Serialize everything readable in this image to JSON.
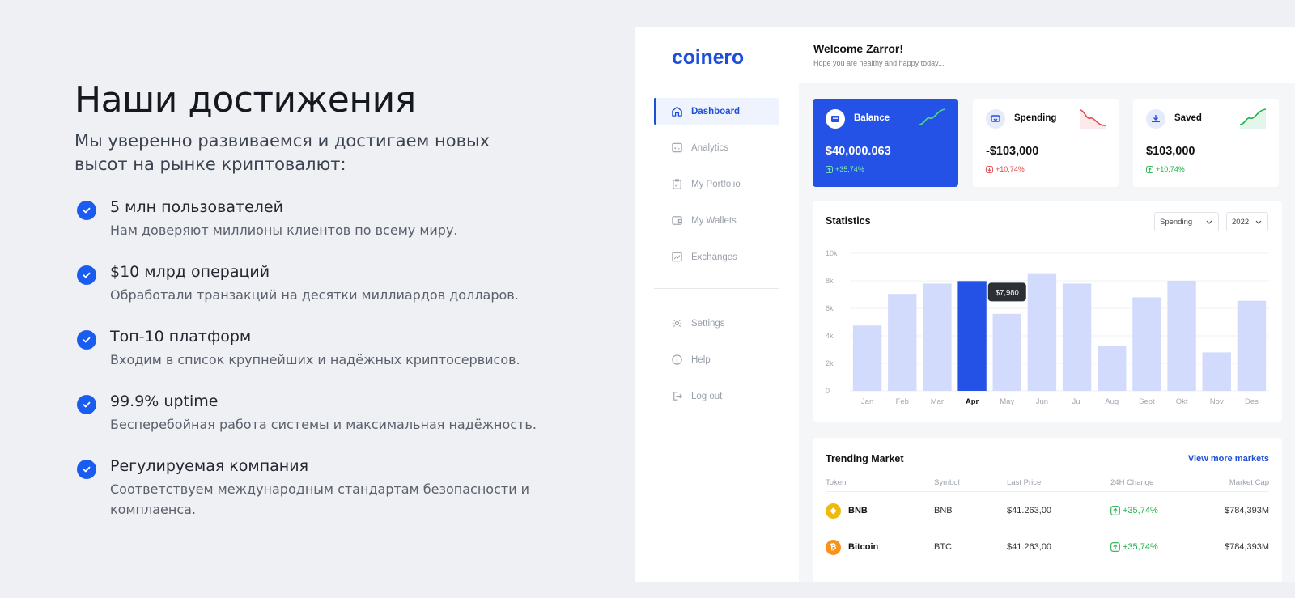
{
  "left": {
    "title": "Наши достижения",
    "subtitle": "Мы уверенно развиваемся и достигаем новых высот на рынке криптовалют:",
    "achievements": [
      {
        "title": "5 млн пользователей",
        "desc": "Нам доверяют миллионы клиентов по всему миру."
      },
      {
        "title": "$10 млрд операций",
        "desc": "Обработали транзакций на десятки миллиардов долларов."
      },
      {
        "title": "Топ-10 платформ",
        "desc": "Входим в список крупнейших и надёжных криптосервисов."
      },
      {
        "title": "99.9% uptime",
        "desc": "Бесперебойная работа системы и максимальная надёжность."
      },
      {
        "title": "Регулируемая компания",
        "desc": "Соответствуем международным стандартам безопасности и комплаенса."
      }
    ]
  },
  "app": {
    "logo": "coinero",
    "welcome": "Welcome Zarror!",
    "welcome_sub": "Hope you are healthy and happy today...",
    "nav": [
      {
        "label": "Dashboard",
        "icon": "home-icon"
      },
      {
        "label": "Analytics",
        "icon": "analytics-icon"
      },
      {
        "label": "My Portfolio",
        "icon": "clipboard-icon"
      },
      {
        "label": "My Wallets",
        "icon": "wallet-icon"
      },
      {
        "label": "Exchanges",
        "icon": "exchange-chart-icon"
      }
    ],
    "nav_bottom": [
      {
        "label": "Settings",
        "icon": "gear-icon"
      },
      {
        "label": "Help",
        "icon": "info-icon"
      },
      {
        "label": "Log out",
        "icon": "logout-icon"
      }
    ],
    "cards": [
      {
        "label": "Balance",
        "value": "$40,000.063",
        "change": "+35,74%",
        "trend": "up"
      },
      {
        "label": "Spending",
        "value": "-$103,000",
        "change": "+10,74%",
        "trend": "down"
      },
      {
        "label": "Saved",
        "value": "$103,000",
        "change": "+10,74%",
        "trend": "up"
      }
    ],
    "statistics": {
      "title": "Statistics",
      "filter": "Spending",
      "year": "2022",
      "tooltip": "$7,980"
    },
    "trending": {
      "title": "Trending Market",
      "more": "View more markets",
      "columns": [
        "Token",
        "Symbol",
        "Last Price",
        "24H Change",
        "Market Cap"
      ],
      "rows": [
        {
          "token": "BNB",
          "symbol": "BNB",
          "price": "$41.263,00",
          "change": "+35,74%",
          "cap": "$784,393M",
          "color": "#f0b90b"
        },
        {
          "token": "Bitcoin",
          "symbol": "BTC",
          "price": "$41.263,00",
          "change": "+35,74%",
          "cap": "$784,393M",
          "color": "#f7931a"
        }
      ]
    },
    "colors": {
      "accent": "#2451e6",
      "bar": "#d3dbfc",
      "up": "#22b14c",
      "down": "#e5484d"
    }
  },
  "chart_data": {
    "type": "bar",
    "title": "Statistics",
    "categories": [
      "Jan",
      "Feb",
      "Mar",
      "Apr",
      "May",
      "Jun",
      "Jul",
      "Aug",
      "Sept",
      "Okt",
      "Nov",
      "Des"
    ],
    "values": [
      4750,
      7050,
      7800,
      7980,
      5600,
      8550,
      7800,
      3250,
      6800,
      8000,
      2800,
      6550
    ],
    "highlight": "Apr",
    "yticks": [
      "0",
      "2k",
      "4k",
      "6k",
      "8k",
      "10k"
    ],
    "ylim": [
      0,
      10000
    ],
    "grid": true
  }
}
